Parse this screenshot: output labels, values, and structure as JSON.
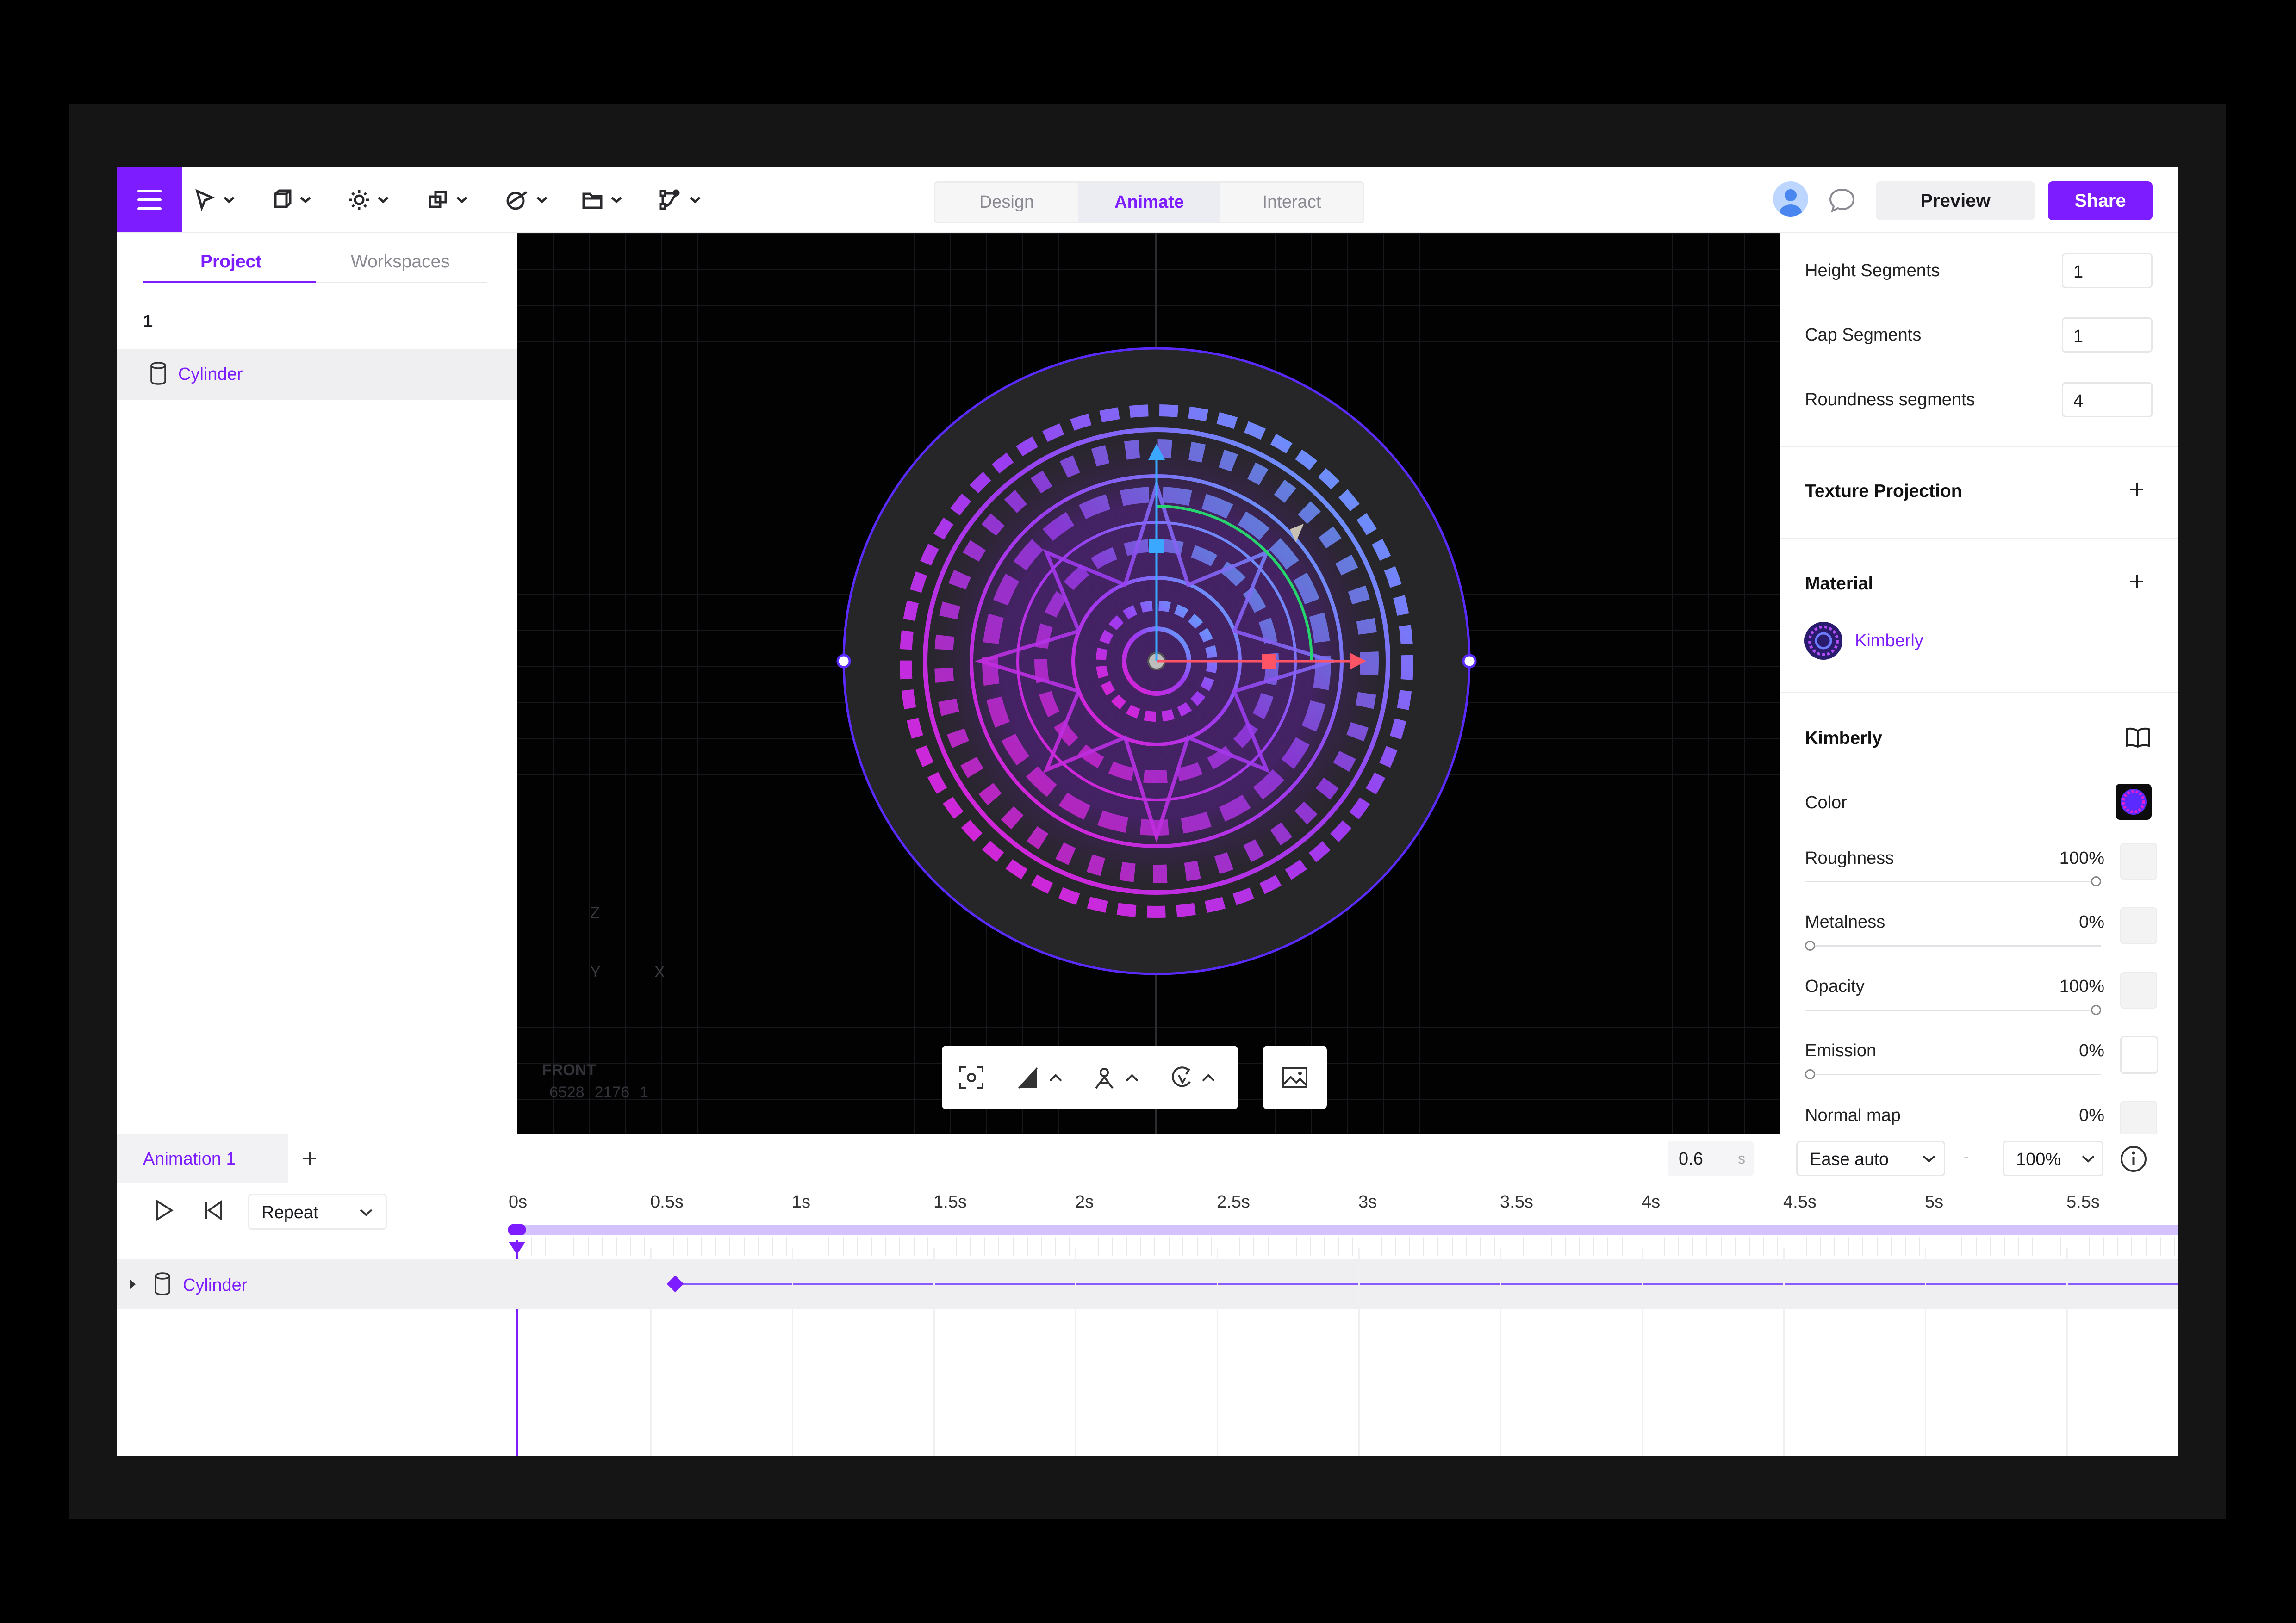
{
  "toolbar": {
    "mode_tabs": [
      "Design",
      "Animate",
      "Interact"
    ],
    "preview_label": "Preview",
    "share_label": "Share"
  },
  "left_panel": {
    "tabs": [
      "Project",
      "Workspaces"
    ],
    "group_label": "1",
    "items": [
      {
        "label": "Cylinder",
        "icon": "cylinder-icon"
      }
    ]
  },
  "viewport": {
    "axis_labels": [
      "Z",
      "Y",
      "X"
    ],
    "view_name": "FRONT",
    "stats": [
      "6528",
      "2176",
      "1"
    ]
  },
  "right_panel": {
    "fields": [
      {
        "label": "Height Segments",
        "value": "1"
      },
      {
        "label": "Cap Segments",
        "value": "1"
      },
      {
        "label": "Roundness segments",
        "value": "4"
      }
    ],
    "texture_projection": "Texture Projection",
    "material_title": "Material",
    "material_name": "Kimberly",
    "material_section_title": "Kimberly",
    "color_label": "Color",
    "properties": [
      {
        "label": "Roughness",
        "value": "100%",
        "level": 1.0
      },
      {
        "label": "Metalness",
        "value": "0%",
        "level": 0.0
      },
      {
        "label": "Opacity",
        "value": "100%",
        "level": 1.0
      },
      {
        "label": "Emission",
        "value": "0%",
        "level": 0.0
      },
      {
        "label": "Normal map",
        "value": "0%",
        "level": 0.0
      }
    ],
    "material_color": "#7c1cff"
  },
  "timeline": {
    "animation_tab": "Animation 1",
    "duration_value": "0.6",
    "duration_unit": "s",
    "ease": "Ease auto",
    "separator": "-",
    "speed": "100%",
    "loop_mode": "Repeat",
    "ruler": [
      "0s",
      "0.5s",
      "1s",
      "1.5s",
      "2s",
      "2.5s",
      "3s",
      "3.5s",
      "4s",
      "4.5s",
      "5s",
      "5.5s"
    ],
    "tracks": [
      {
        "label": "Cylinder",
        "keyframe_time": "0.6s"
      }
    ]
  },
  "colors": {
    "accent": "#7c1cff",
    "timeline_bar": "#d4c2ff"
  }
}
